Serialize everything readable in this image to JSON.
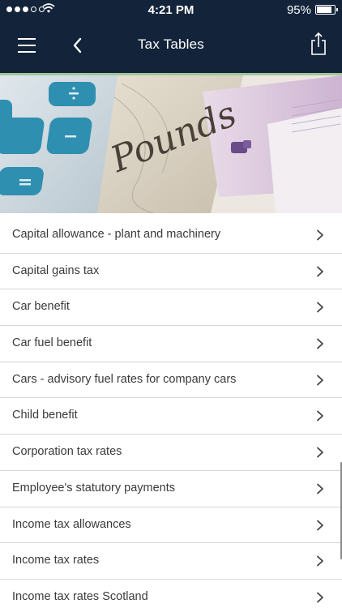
{
  "status_bar": {
    "signal_dots": 5,
    "signal_on": 3,
    "time": "4:21 PM",
    "battery_text": "95%",
    "battery_level": 0.95
  },
  "nav": {
    "title": "Tax Tables",
    "menu_icon": "hamburger-menu-icon",
    "back_icon": "chevron-left-icon",
    "share_icon": "share-icon"
  },
  "colors": {
    "header_bg": "#13233a",
    "accent_bar": "#9fc69a",
    "divider": "#d6d6d6"
  },
  "banner": {
    "subject": "calculator on pound banknotes",
    "banknote_word": "Pounds"
  },
  "items": [
    {
      "label": "Capital allowance - plant and machinery"
    },
    {
      "label": "Capital gains tax"
    },
    {
      "label": "Car benefit"
    },
    {
      "label": "Car fuel benefit"
    },
    {
      "label": "Cars - advisory fuel rates for company cars"
    },
    {
      "label": "Child benefit"
    },
    {
      "label": "Corporation tax rates"
    },
    {
      "label": "Employee's statutory payments"
    },
    {
      "label": "Income tax allowances"
    },
    {
      "label": "Income tax rates"
    },
    {
      "label": "Income tax rates Scotland"
    }
  ]
}
